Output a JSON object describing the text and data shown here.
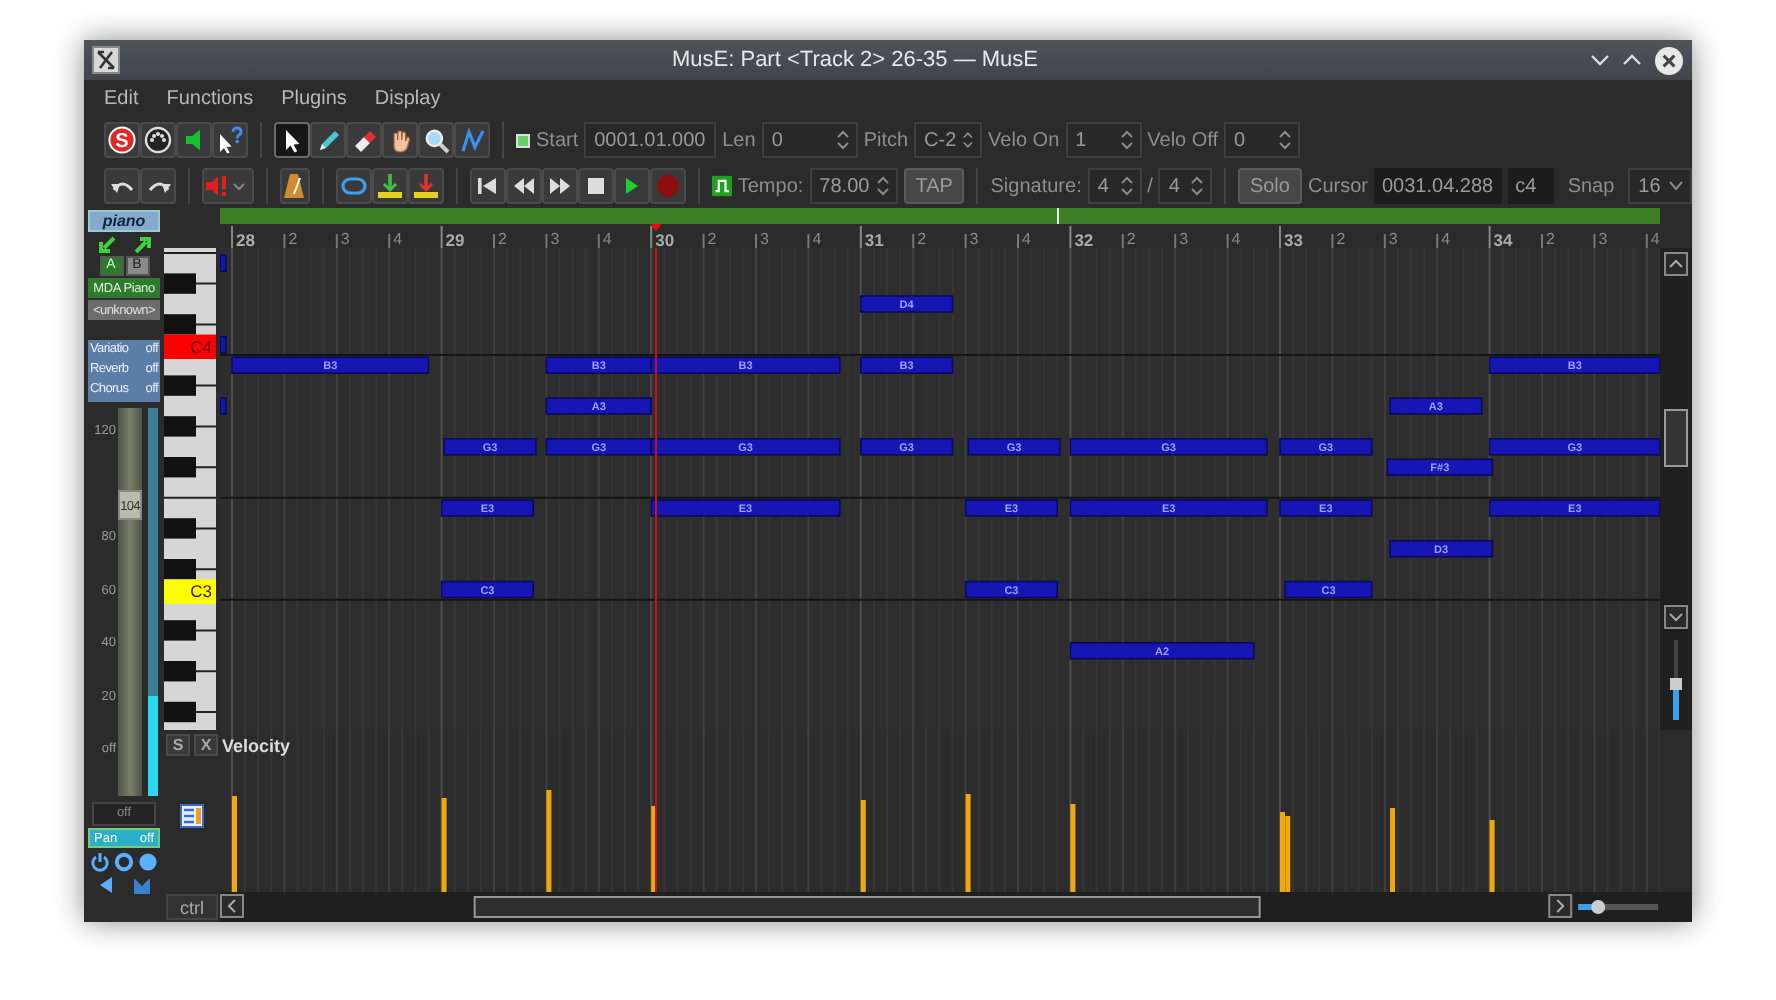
{
  "window": {
    "title": "MusE: Part <Track 2> 26-35 — MusE"
  },
  "menu": [
    "Edit",
    "Functions",
    "Plugins",
    "Display"
  ],
  "toolbar": {
    "step_record_glyph": "S",
    "tools": [
      {
        "kind": "pointer",
        "selected": true
      },
      {
        "kind": "pencil",
        "selected": false
      },
      {
        "kind": "eraser",
        "selected": false
      },
      {
        "kind": "hand",
        "selected": false
      },
      {
        "kind": "zoom",
        "selected": false
      },
      {
        "kind": "line",
        "selected": false
      }
    ],
    "fields": [
      {
        "label": "Start",
        "value": "0001.01.000"
      },
      {
        "label": "Len",
        "value": "0"
      },
      {
        "label": "Pitch",
        "value": "C-2"
      },
      {
        "label": "Velo On",
        "value": "1"
      },
      {
        "label": "Velo Off",
        "value": "0"
      }
    ]
  },
  "transport_bar": {
    "tempo_label": "Tempo:",
    "tempo": "78.00",
    "tap": "TAP",
    "signature_label": "Signature:",
    "sig_num": "4",
    "sig_sep": "/",
    "sig_den": "4",
    "solo": "Solo",
    "cursor_label": "Cursor",
    "cursor": "0031.04.288",
    "cursor_pitch": "c4",
    "snap_label": "Snap",
    "snap": "16"
  },
  "track_panel": {
    "instrument_button": "piano",
    "ab": [
      {
        "label": "A",
        "selected": true
      },
      {
        "label": "B",
        "selected": false
      }
    ],
    "synth": "MDA Piano",
    "patch": "<unknown>",
    "effects": [
      {
        "label": "Variatio",
        "value": "off"
      },
      {
        "label": "Reverb",
        "value": "off"
      },
      {
        "label": "Chorus",
        "value": "off"
      }
    ],
    "volume": {
      "scale": [
        "120",
        "80",
        "60",
        "40",
        "20",
        "off"
      ],
      "handle": "104",
      "level": 0.77
    },
    "meter": {
      "level": 0.26
    },
    "volume_field": "off",
    "pan": {
      "label": "Pan",
      "value": "off"
    }
  },
  "keyboard": {
    "highlighted_keys": [
      {
        "label": "C4",
        "color": "#ff0000"
      },
      {
        "label": "C3",
        "color": "#ffff00"
      }
    ]
  },
  "ruler": [
    {
      "bar": "28",
      "beats": [
        "2",
        "3",
        "4"
      ]
    },
    {
      "bar": "29",
      "beats": [
        "2",
        "3",
        "4"
      ]
    },
    {
      "bar": "30",
      "beats": [
        "2",
        "3",
        "4"
      ]
    },
    {
      "bar": "31",
      "beats": [
        "2",
        "3",
        "4"
      ]
    },
    {
      "bar": "32",
      "beats": [
        "2",
        "3",
        "4"
      ]
    },
    {
      "bar": "33",
      "beats": [
        "2",
        "3",
        "4"
      ]
    },
    {
      "bar": "34",
      "beats": [
        "2",
        "3",
        "4"
      ]
    }
  ],
  "notes": [
    {
      "kind": "clipped"
    },
    {
      "kind": "clipped"
    },
    {
      "kind": "clipped"
    },
    {
      "kind": "note",
      "label": "D4"
    },
    {
      "kind": "note",
      "label": "B3"
    },
    {
      "kind": "note",
      "label": "B3"
    },
    {
      "kind": "note",
      "label": "B3"
    },
    {
      "kind": "note",
      "label": "B3"
    },
    {
      "kind": "note",
      "label": "B3"
    },
    {
      "kind": "note",
      "label": "A3"
    },
    {
      "kind": "note",
      "label": "A3"
    },
    {
      "kind": "note",
      "label": "G3"
    },
    {
      "kind": "note",
      "label": "G3"
    },
    {
      "kind": "note",
      "label": "G3"
    },
    {
      "kind": "note",
      "label": "G3"
    },
    {
      "kind": "note",
      "label": "G3"
    },
    {
      "kind": "note",
      "label": "G3"
    },
    {
      "kind": "note",
      "label": "G3"
    },
    {
      "kind": "note",
      "label": "G3"
    },
    {
      "kind": "note",
      "label": "F#3"
    },
    {
      "kind": "note",
      "label": "E3"
    },
    {
      "kind": "note",
      "label": "E3"
    },
    {
      "kind": "note",
      "label": "E3"
    },
    {
      "kind": "note",
      "label": "E3"
    },
    {
      "kind": "note",
      "label": "E3"
    },
    {
      "kind": "note",
      "label": "E3"
    },
    {
      "kind": "note",
      "label": "D3"
    },
    {
      "kind": "note",
      "label": "C3"
    },
    {
      "kind": "note",
      "label": "C3"
    },
    {
      "kind": "note",
      "label": "C3"
    },
    {
      "kind": "note",
      "label": "A2"
    }
  ],
  "pitch_zoom": {
    "level": 0.45
  },
  "time_zoom": {
    "level": 0.25
  },
  "controller": {
    "s_button": "S",
    "x_button": "X",
    "label": "Velocity",
    "ctrl_button": "ctrl"
  }
}
